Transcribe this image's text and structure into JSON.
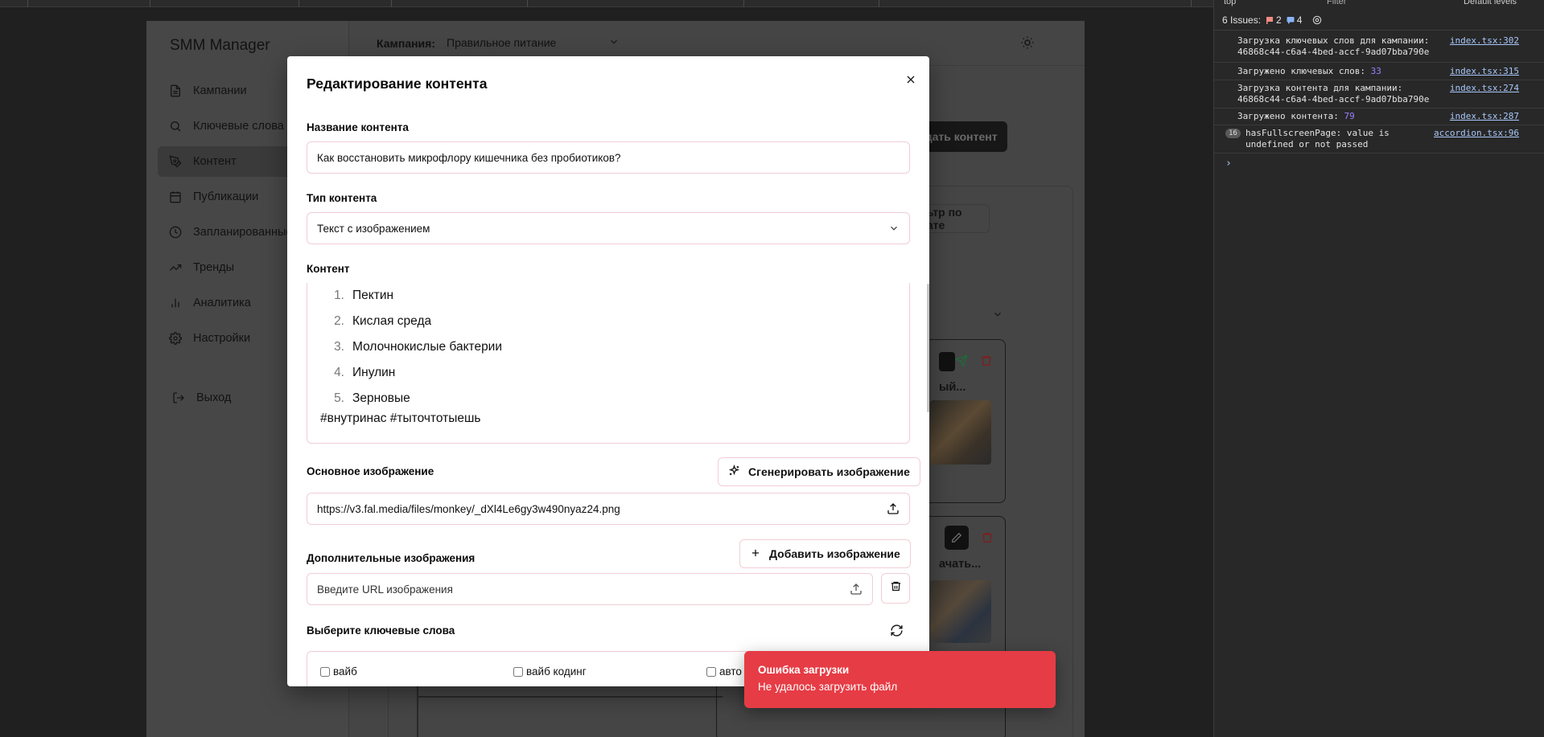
{
  "app": {
    "brand": "SMM Manager",
    "campaign_label": "Кампания:",
    "campaign_value": "Правильное питание",
    "nav": [
      {
        "label": "Кампании",
        "icon": "file-icon"
      },
      {
        "label": "Ключевые слова",
        "icon": "search-icon"
      },
      {
        "label": "Контент",
        "icon": "pen-icon"
      },
      {
        "label": "Публикации",
        "icon": "calendar-icon"
      },
      {
        "label": "Запланированные",
        "icon": "clock-icon"
      },
      {
        "label": "Тренды",
        "icon": "trend-icon"
      },
      {
        "label": "Аналитика",
        "icon": "bar-chart-icon"
      },
      {
        "label": "Настройки",
        "icon": "gear-icon"
      }
    ],
    "logout": "Выход",
    "create_content_partial": "оздать контент",
    "date_filter_partial": "льтр по дате",
    "card1_title_partial": "ый...",
    "card2_title_partial": "ачать..."
  },
  "modal": {
    "title": "Редактирование контента",
    "name_label": "Название контента",
    "name_value": "Как восстановить микрофлору кишечника без пробиотиков?",
    "type_label": "Тип контента",
    "type_value": "Текст с изображением",
    "content_label": "Контент",
    "content_items": [
      {
        "num": "1.",
        "text": "Пектин"
      },
      {
        "num": "2.",
        "text": "Кислая среда"
      },
      {
        "num": "3.",
        "text": "Молочнокислые бактерии"
      },
      {
        "num": "4.",
        "text": "Инулин"
      },
      {
        "num": "5.",
        "text": "Зерновые"
      }
    ],
    "hashtags": "#внутринас #тыточтотыешь",
    "main_image_label": "Основное изображение",
    "generate_image_button": "Сгенерировать изображение",
    "main_image_url": "https://v3.fal.media/files/monkey/_dXl4Le6gy3w490nyaz24.png",
    "additional_images_label": "Дополнительные изображения",
    "add_image_button": "Добавить изображение",
    "additional_image_placeholder": "Введите URL изображения",
    "keywords_label": "Выберите ключевые слова",
    "keywords": [
      "вайб",
      "вайб кодинг",
      "авто"
    ]
  },
  "toast": {
    "title": "Ошибка загрузки",
    "message": "Не удалось загрузить файл",
    "color": "#e63c45"
  },
  "devtools": {
    "context": "top",
    "filter_placeholder": "Filter",
    "levels": "Default levels",
    "issues_label": "6 Issues:",
    "issues_errors": "2",
    "issues_info": "4",
    "logs": [
      {
        "text": "Загрузка ключевых слов для кампании:\n46868c44-c6a4-4bed-accf-9ad07bba790e",
        "source": "index.tsx:302"
      },
      {
        "text": "Загружено ключевых слов: ",
        "num": "33",
        "source": "index.tsx:315"
      },
      {
        "text": "Загрузка контента для кампании:\n46868c44-c6a4-4bed-accf-9ad07bba790e",
        "source": "index.tsx:274"
      },
      {
        "text": "Загружено контента: ",
        "num": "79",
        "source": "index.tsx:287"
      },
      {
        "count": "16",
        "text": "hasFullscreenPage: value is\nundefined or not passed",
        "source": "accordion.tsx:96"
      }
    ],
    "prompt": "›"
  }
}
